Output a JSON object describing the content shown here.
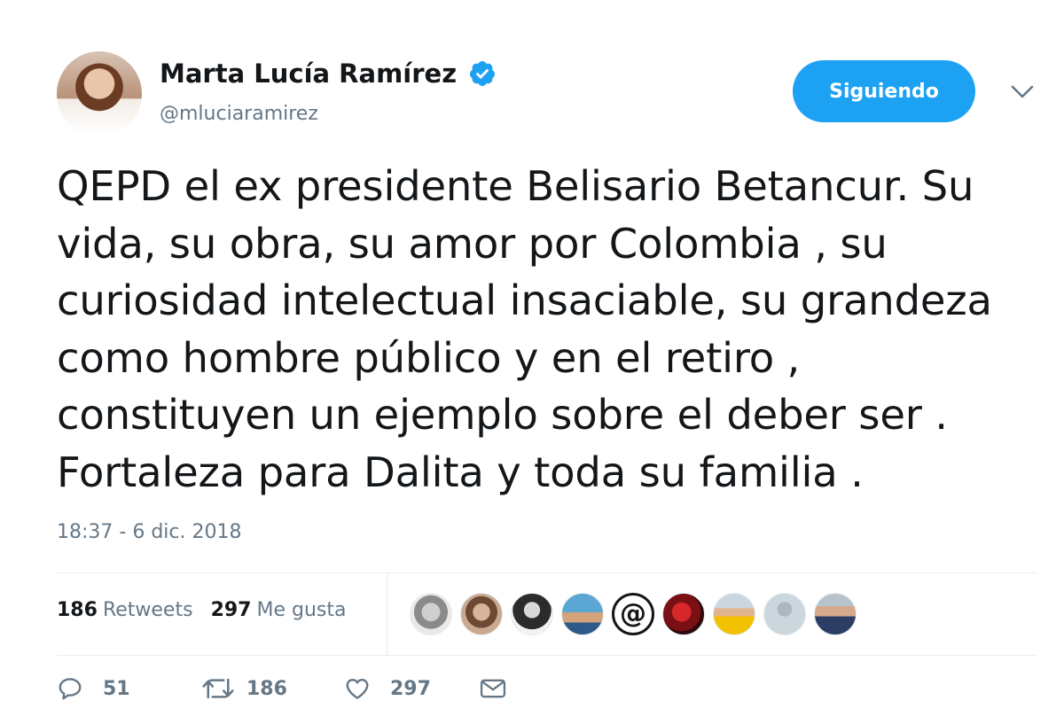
{
  "author": {
    "name": "Marta Lucía Ramírez",
    "handle": "@mluciaramirez",
    "verified": true
  },
  "follow_button": {
    "label": "Siguiendo"
  },
  "tweet": {
    "text": "QEPD el ex presidente Belisario Betancur. Su\nvida, su obra, su amor por Colombia , su\ncuriosidad intelectual insaciable, su grandeza\ncomo hombre público y en el retiro ,\n constituyen un ejemplo sobre el deber ser .\n Fortaleza para Dalita y toda su familia .",
    "timestamp": "18:37 - 6 dic. 2018"
  },
  "stats": {
    "retweets_count": "186",
    "retweets_label": "Retweets",
    "likes_count": "297",
    "likes_label": "Me gusta"
  },
  "actions": {
    "reply_count": "51",
    "retweet_count": "186",
    "like_count": "297"
  },
  "colors": {
    "accent": "#1da1f2",
    "muted_text": "#657786",
    "divider": "#e6ecf0"
  },
  "icons": [
    "verified-badge-icon",
    "chevron-down-icon",
    "reply-icon",
    "retweet-icon",
    "heart-icon",
    "envelope-icon"
  ]
}
